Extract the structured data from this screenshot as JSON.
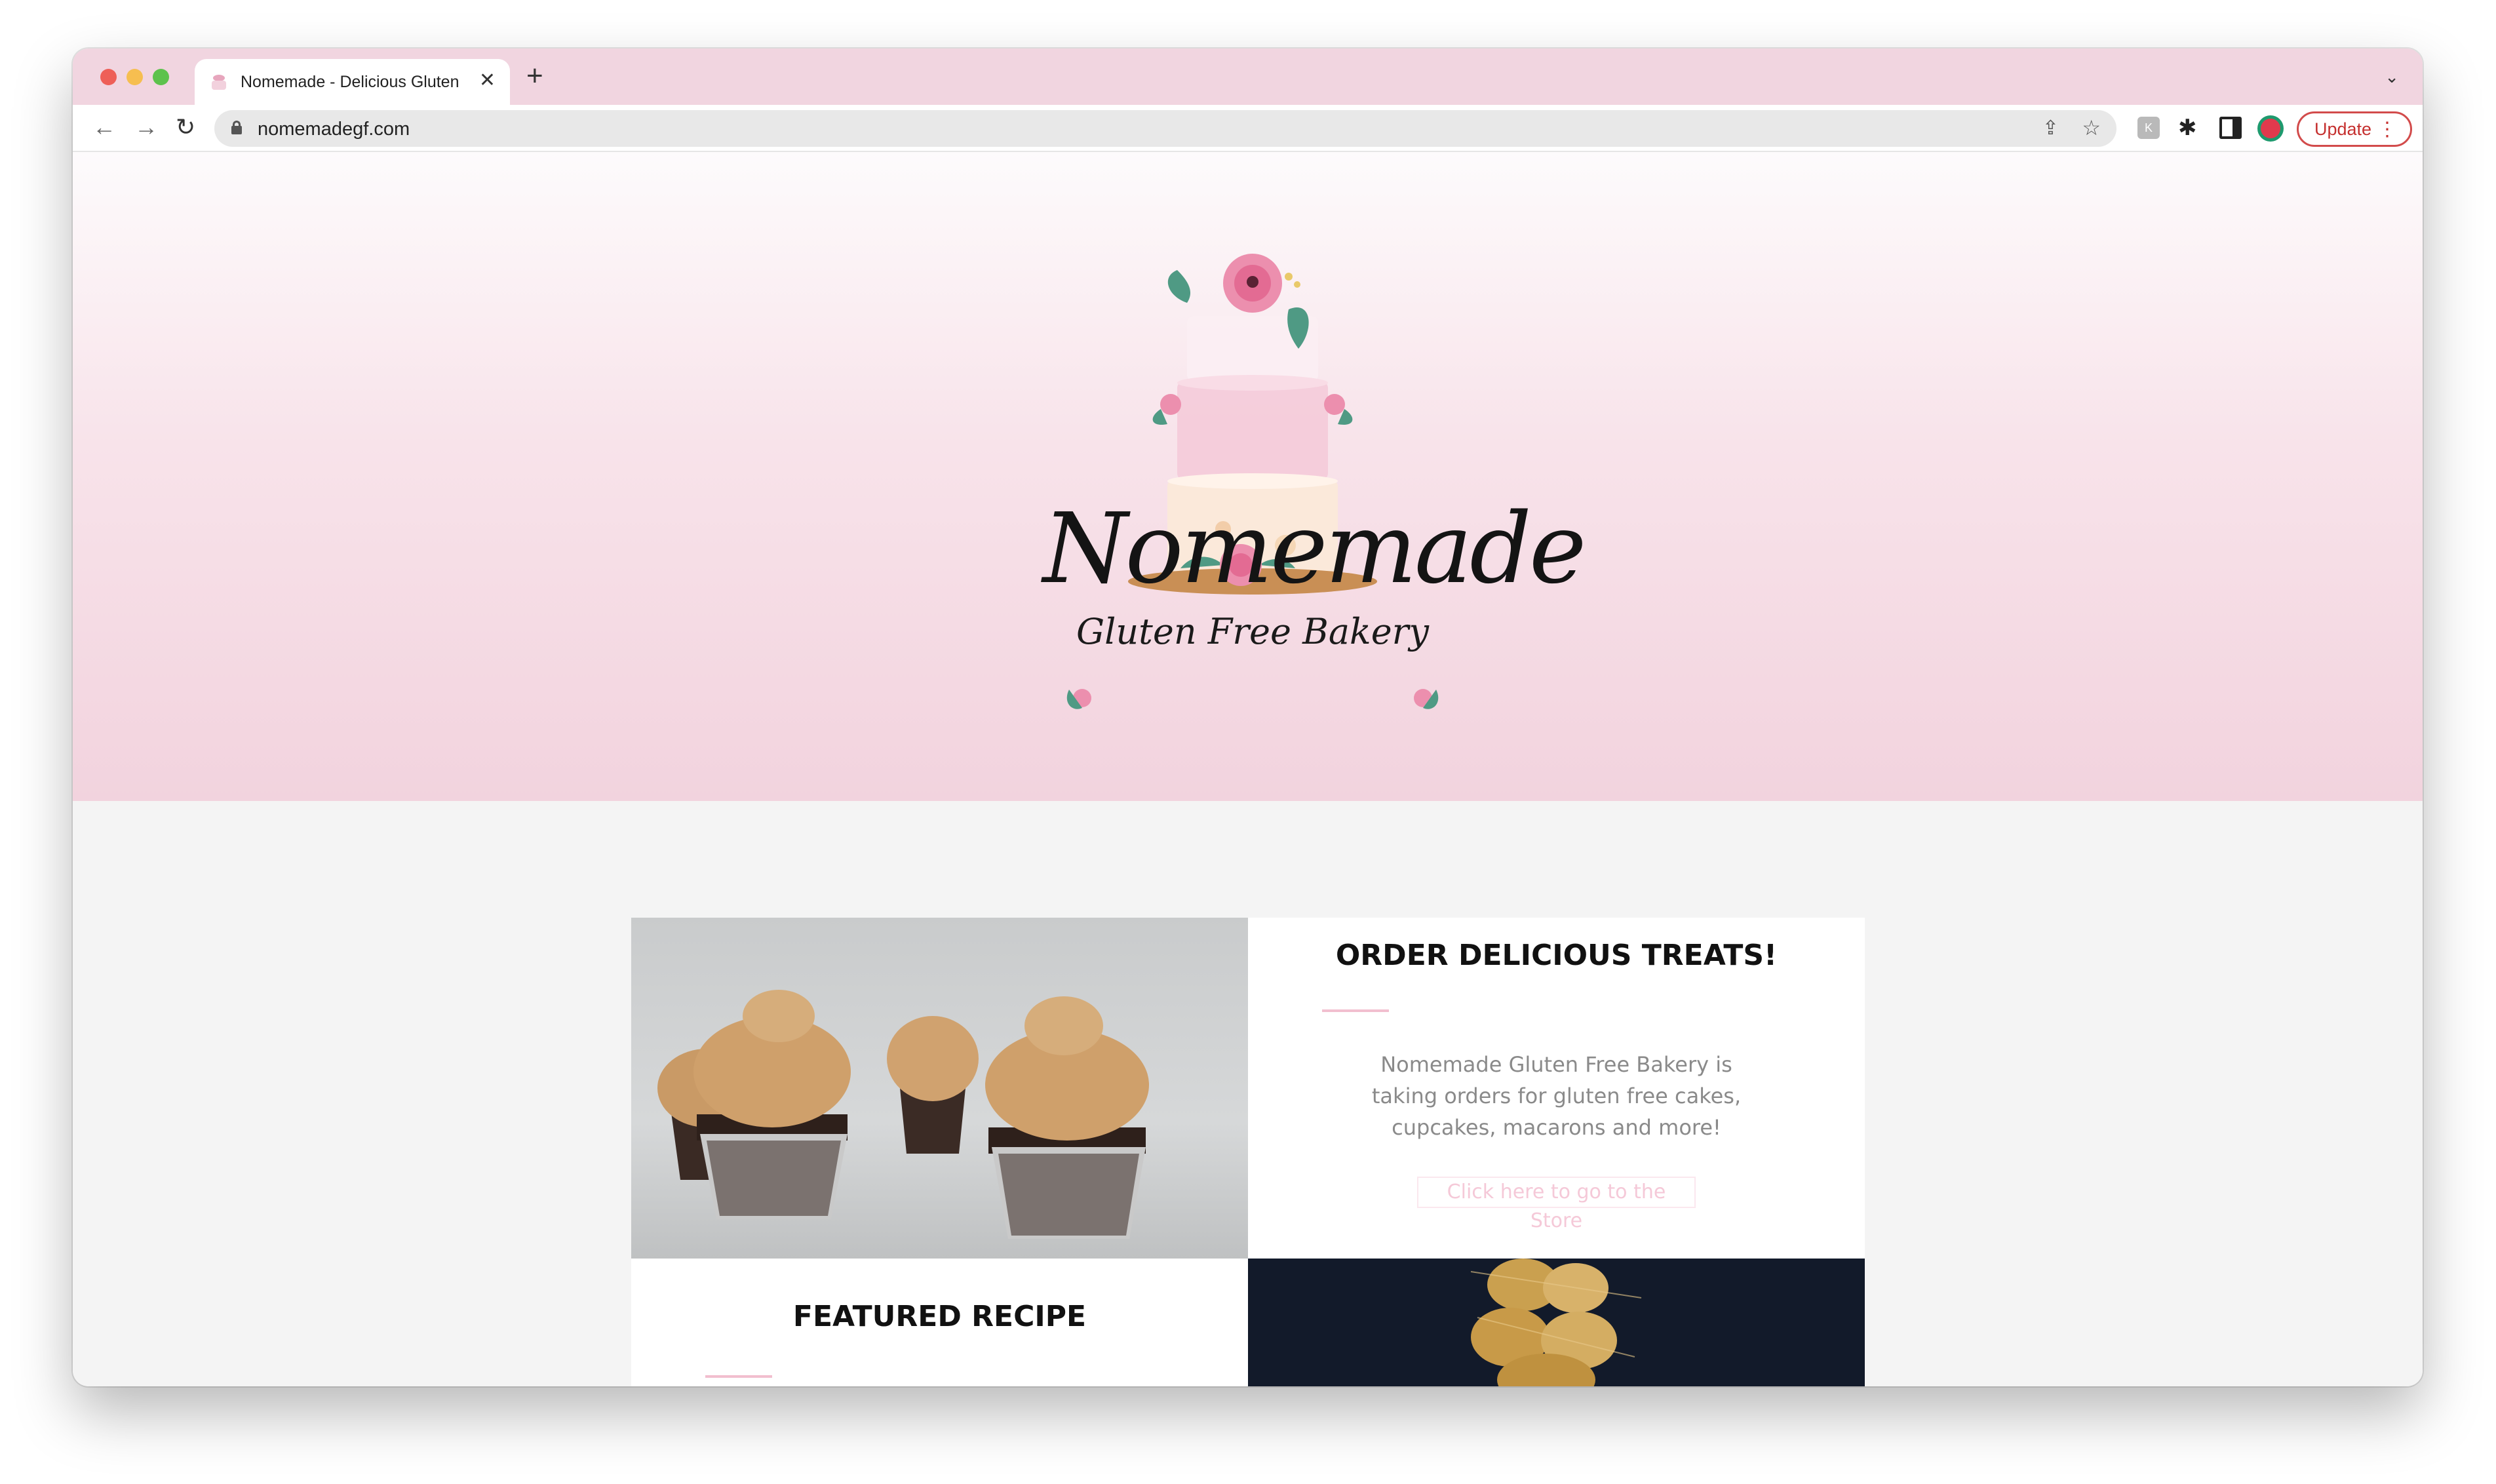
{
  "browser": {
    "tab_title": "Nomemade - Delicious Gluten Free",
    "tab_close": "✕",
    "new_tab": "+",
    "tab_list": "⌄",
    "url": "nomemadegf.com",
    "back": "←",
    "forward": "→",
    "reload": "↻",
    "share": "⇪",
    "bookmark": "☆",
    "extension_puzzle": "✱",
    "update_label": "Update",
    "menu_dots": "⋮"
  },
  "hero": {
    "logo_wordmark": "Nomemade",
    "logo_tagline": "Gluten Free Bakery"
  },
  "cards": {
    "order": {
      "title": "ORDER DELICIOUS TREATS!",
      "body": "Nomemade Gluten Free Bakery is taking orders for gluten free cakes, cupcakes, macarons and more!",
      "link": "Click here to go to the Store"
    },
    "featured": {
      "title": "FEATURED RECIPE"
    }
  },
  "colors": {
    "tabstrip": "#f1d5e0",
    "hero_bottom": "#f2d3de",
    "accent_pink": "#f2bfcf",
    "update_red": "#c5302f"
  }
}
